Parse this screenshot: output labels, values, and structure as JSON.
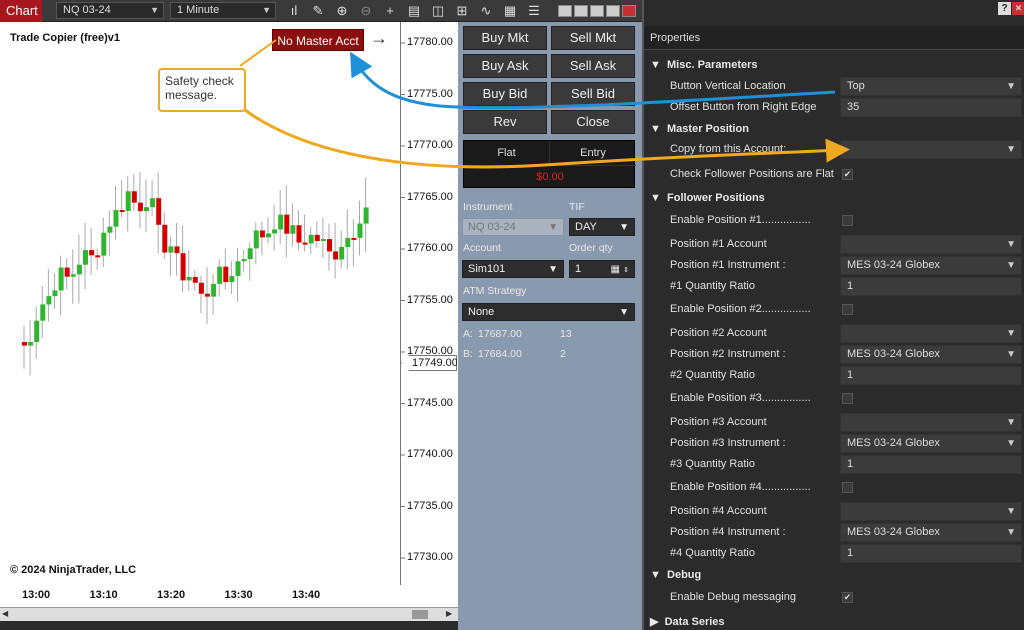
{
  "toolbar": {
    "chart_tab": "Chart",
    "instrument": "NQ 03-24",
    "interval": "1 Minute"
  },
  "chart": {
    "title": "Trade Copier (free)v1",
    "copyright": "© 2024 NinjaTrader, LLC",
    "no_master_button": "No Master Acct",
    "arrow": "→",
    "callout": "Safety check message.",
    "price_ticks": [
      "17780.00",
      "17775.00",
      "17770.00",
      "17765.00",
      "17760.00",
      "17755.00",
      "17750.00",
      "17745.00",
      "17740.00",
      "17735.00",
      "17730.00"
    ],
    "price_tag": "17749.00",
    "time_ticks": [
      "13:00",
      "13:10",
      "13:20",
      "13:30",
      "13:40"
    ],
    "colors": {
      "up": "#2fb52f",
      "down": "#d40000",
      "callout_border": "#f0a81e",
      "blue_arrow": "#1e90d8",
      "orange_arrow": "#f0a81e"
    }
  },
  "order": {
    "buttons": [
      {
        "label": "Buy Mkt"
      },
      {
        "label": "Sell Mkt"
      },
      {
        "label": "Buy Ask"
      },
      {
        "label": "Sell Ask"
      },
      {
        "label": "Buy Bid"
      },
      {
        "label": "Sell Bid"
      },
      {
        "label": "Rev"
      },
      {
        "label": "Close"
      }
    ],
    "flat_label": "Flat",
    "entry_label": "Entry",
    "pnl": "$0.00",
    "instrument_label": "Instrument",
    "instrument_value": "NQ 03-24",
    "tif_label": "TIF",
    "tif_value": "DAY",
    "account_label": "Account",
    "account_value": "Sim101",
    "qty_label": "Order qty",
    "qty_value": "1",
    "atm_label": "ATM Strategy",
    "atm_value": "None",
    "a_label": "A:",
    "a_price": "17687.00",
    "a_size": "13",
    "b_label": "B:",
    "b_price": "17684.00",
    "b_size": "2"
  },
  "props": {
    "title": "Properties",
    "help": "?",
    "close": "✕",
    "sections": {
      "misc": "Misc. Parameters",
      "master": "Master Position",
      "follower": "Follower Positions",
      "debug": "Debug",
      "data": "Data Series"
    },
    "rows": {
      "btn_loc_label": "Button Vertical Location",
      "btn_loc_value": "Top",
      "offset_label": "Offset Button from Right Edge",
      "offset_value": "35",
      "copy_label": "Copy from this Account:",
      "copy_value": "",
      "check_flat_label": "Check Follower Positions are Flat",
      "en1": "Enable Position #1................",
      "acc1": "Position #1 Account",
      "ins1": "Position #1 Instrument :",
      "ins1_value": "MES 03-24 Globex",
      "qr1": "#1 Quantity Ratio",
      "qr1_value": "1",
      "en2": "Enable Position #2................",
      "acc2": "Position #2 Account",
      "ins2": "Position #2 Instrument :",
      "ins2_value": "MES 03-24 Globex",
      "qr2": "#2 Quantity Ratio",
      "qr2_value": "1",
      "en3": "Enable Position #3................",
      "acc3": "Position #3 Account",
      "ins3": "Position #3 Instrument :",
      "ins3_value": "MES 03-24 Globex",
      "qr3": "#3 Quantity Ratio",
      "qr3_value": "1",
      "en4": "Enable Position #4................",
      "acc4": "Position #4 Account",
      "ins4": "Position #4 Instrument :",
      "ins4_value": "MES 03-24 Globex",
      "qr4": "#4 Quantity Ratio",
      "qr4_value": "1",
      "debug_label": "Enable Debug messaging"
    }
  }
}
